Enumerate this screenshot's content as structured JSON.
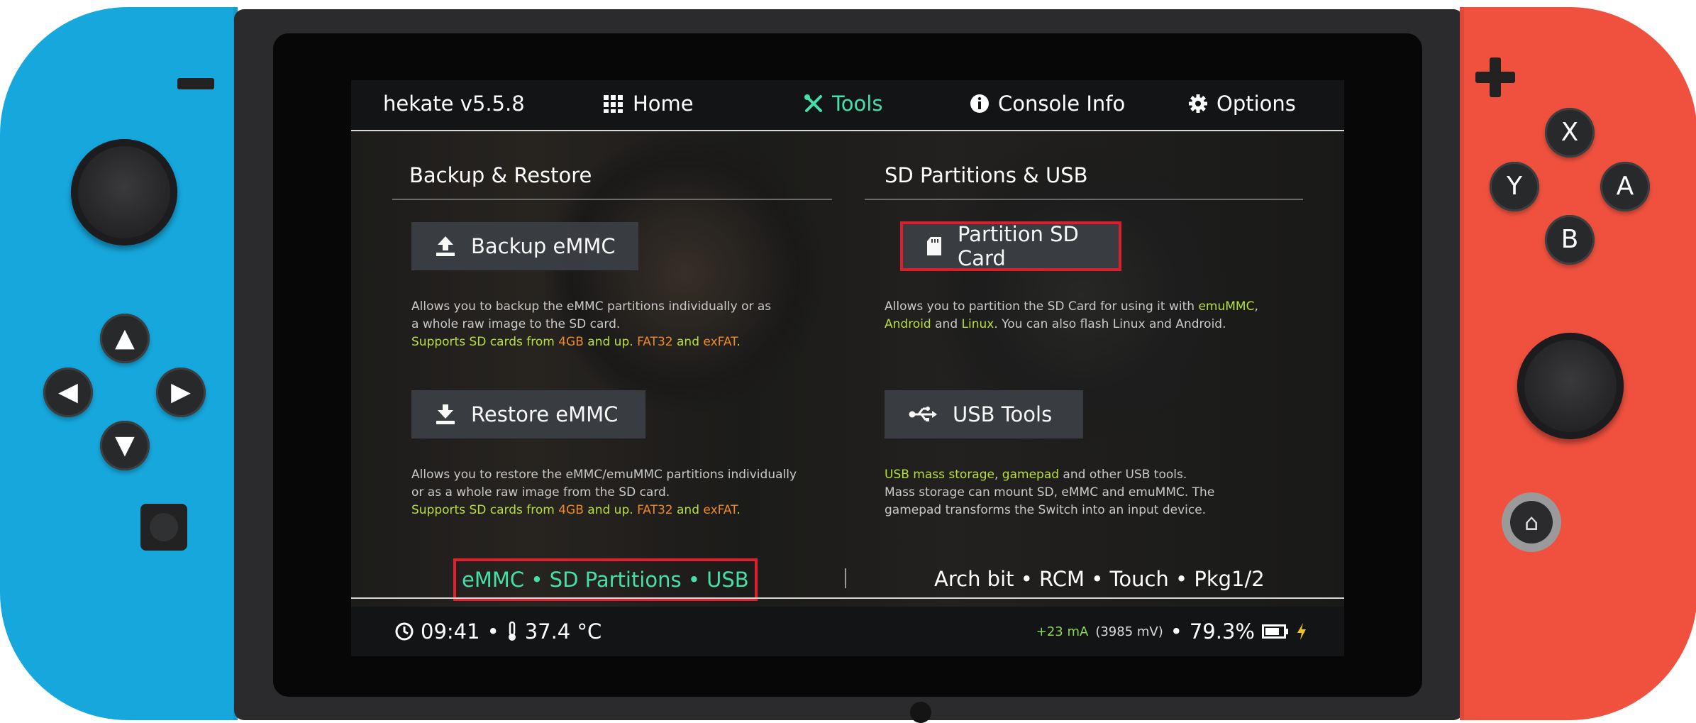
{
  "app": {
    "title": "hekate v5.5.8"
  },
  "nav": {
    "home": "Home",
    "tools": "Tools",
    "console_info": "Console Info",
    "options": "Options"
  },
  "sections": {
    "left_title": "Backup & Restore",
    "right_title": "SD Partitions & USB"
  },
  "buttons": {
    "backup": "Backup eMMC",
    "restore": "Restore eMMC",
    "partition": "Partition SD Card",
    "usb": "USB Tools"
  },
  "descriptions": {
    "backup_l1": "Allows you to backup the eMMC partitions individually or as",
    "backup_l2": "a whole raw image to the SD card.",
    "restore_l1": "Allows you to restore the eMMC/emuMMC partitions individually",
    "restore_l2": "or as a whole raw image from the SD card.",
    "supports_a": "Supports SD cards from ",
    "supports_b": "4GB",
    "supports_c": " and up. ",
    "supports_d": "FAT32",
    "supports_e": " and ",
    "supports_f": "exFAT",
    "supports_g": ".",
    "partition_a": "Allows you to partition the SD Card for using it with ",
    "partition_b": "emuMMC",
    "partition_c": ",",
    "partition_d": "Android",
    "partition_e": " and ",
    "partition_f": "Linux",
    "partition_g": ". You can also flash Linux and Android.",
    "usb_a": "USB mass storage",
    "usb_b": ", ",
    "usb_c": "gamepad",
    "usb_d": " and other USB tools.",
    "usb_l2": "Mass storage can mount SD, eMMC and emuMMC. The",
    "usb_l3": "gamepad transforms the Switch into an input device."
  },
  "tabs": {
    "left": "eMMC • SD Partitions • USB",
    "right": "Arch bit • RCM • Touch • Pkg1/2"
  },
  "status": {
    "time": "09:41",
    "temp": "37.4 °C",
    "current": "+23 mA",
    "voltage": "(3985 mV)",
    "battery": "79.3%"
  },
  "joycon_buttons": {
    "x": "X",
    "y": "Y",
    "a": "A",
    "b": "B"
  },
  "colors": {
    "accent": "#44e0a8",
    "highlight": "#e0202e",
    "left_joycon": "#16a7dc",
    "right_joycon": "#f0513f",
    "green_text": "#b7e03a",
    "orange_text": "#f08a24"
  },
  "icons": {
    "home": "grid-icon",
    "tools": "tools-icon",
    "console_info": "info-icon",
    "options": "gear-icon",
    "backup": "upload-icon",
    "restore": "download-icon",
    "partition": "sd-card-icon",
    "usb": "usb-icon",
    "time": "clock-icon",
    "temp": "thermometer-icon",
    "battery": "battery-icon",
    "charging": "bolt-icon"
  }
}
